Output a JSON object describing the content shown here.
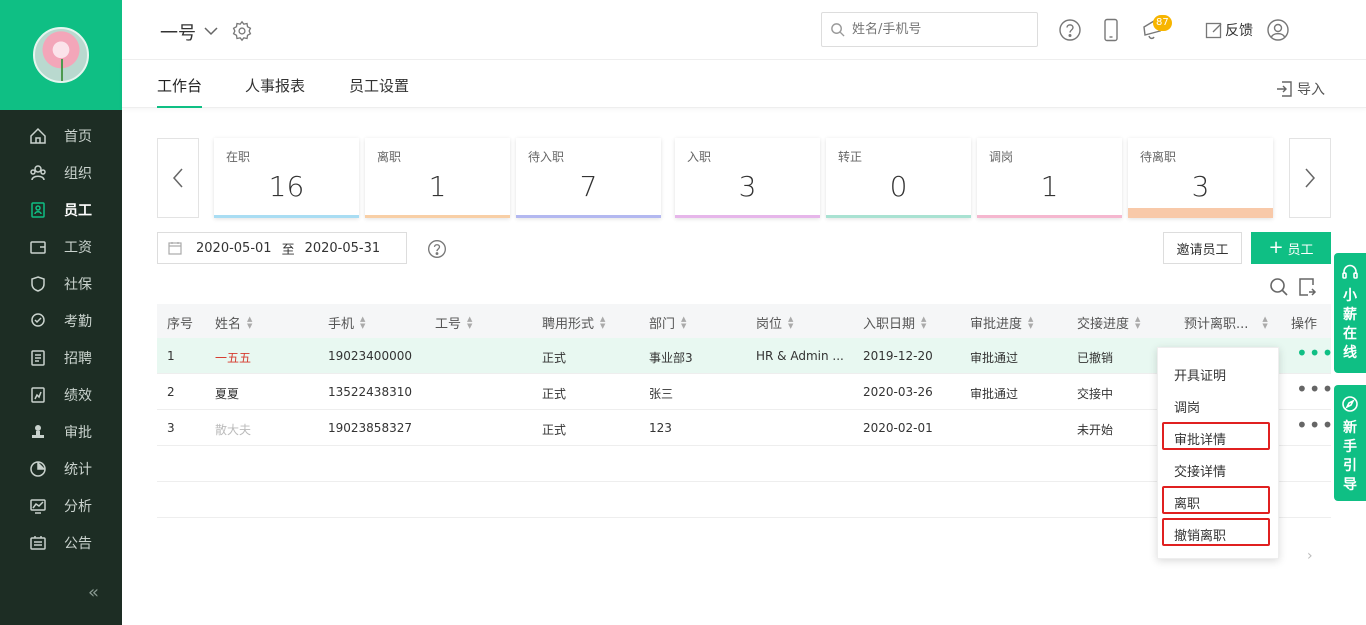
{
  "sidebar": {
    "items": [
      {
        "label": "首页",
        "icon": "home-icon",
        "active": false
      },
      {
        "label": "组织",
        "icon": "org-icon",
        "active": false
      },
      {
        "label": "员工",
        "icon": "employee-icon",
        "active": true
      },
      {
        "label": "工资",
        "icon": "wallet-icon",
        "active": false
      },
      {
        "label": "社保",
        "icon": "shield-icon",
        "active": false
      },
      {
        "label": "考勤",
        "icon": "location-check-icon",
        "active": false
      },
      {
        "label": "招聘",
        "icon": "recruit-icon",
        "active": false
      },
      {
        "label": "绩效",
        "icon": "performance-icon",
        "active": false
      },
      {
        "label": "审批",
        "icon": "stamp-icon",
        "active": false
      },
      {
        "label": "统计",
        "icon": "pie-chart-icon",
        "active": false
      },
      {
        "label": "分析",
        "icon": "analysis-icon",
        "active": false
      },
      {
        "label": "公告",
        "icon": "notice-icon",
        "active": false
      }
    ],
    "collapse_glyph": "«"
  },
  "header": {
    "company": "一号",
    "search_placeholder": "姓名/手机号",
    "notification_count": "87",
    "feedback": "反馈"
  },
  "tabs": [
    {
      "label": "工作台",
      "active": true
    },
    {
      "label": "人事报表",
      "active": false
    },
    {
      "label": "员工设置",
      "active": false
    }
  ],
  "import_label": "导入",
  "stats": [
    {
      "label": "在职",
      "value": "16",
      "color": "#a9ddf3"
    },
    {
      "label": "离职",
      "value": "1",
      "color": "#f8cfa6"
    },
    {
      "label": "待入职",
      "value": "7",
      "color": "#b3b8f0"
    },
    {
      "label": "入职",
      "value": "3",
      "color": "#e6b6ea"
    },
    {
      "label": "转正",
      "value": "0",
      "color": "#a9e2d2"
    },
    {
      "label": "调岗",
      "value": "1",
      "color": "#f5b7cf"
    },
    {
      "label": "待离职",
      "value": "3",
      "color": "#f8c9a9"
    }
  ],
  "filter": {
    "date_start": "2020-05-01",
    "date_sep": "至",
    "date_end": "2020-05-31",
    "invite_label": "邀请员工",
    "add_label": "员工"
  },
  "table": {
    "headers": [
      "序号",
      "姓名",
      "手机",
      "工号",
      "聘用形式",
      "部门",
      "岗位",
      "入职日期",
      "审批进度",
      "交接进度",
      "预计离职...",
      "操作"
    ],
    "rows": [
      {
        "no": "1",
        "name": "一五五",
        "phone": "19023400000",
        "job_no": "",
        "type": "正式",
        "dept": "事业部3",
        "post": "HR & Admin ...",
        "join_date": "2019-12-20",
        "approval": "审批通过",
        "handover": "已撤销",
        "expected": ""
      },
      {
        "no": "2",
        "name": "夏夏",
        "phone": "13522438310",
        "job_no": "",
        "type": "正式",
        "dept": "张三",
        "post": "",
        "join_date": "2020-03-26",
        "approval": "审批通过",
        "handover": "交接中",
        "expected": ""
      },
      {
        "no": "3",
        "name": "散大夫",
        "phone": "19023858327",
        "job_no": "",
        "type": "正式",
        "dept": "123",
        "post": "",
        "join_date": "2020-02-01",
        "approval": "",
        "handover": "未开始",
        "expected": ""
      }
    ]
  },
  "menu": {
    "items": [
      "开具证明",
      "调岗",
      "审批详情",
      "交接详情",
      "离职",
      "撤销离职"
    ]
  },
  "float_tabs": [
    {
      "label": "小薪在线",
      "icon": "headset-icon"
    },
    {
      "label": "新手引导",
      "icon": "compass-icon"
    }
  ],
  "pager_next": "›",
  "colors": {
    "accent": "#0fbf84",
    "sidebar": "#1d2d24",
    "highlight": "#e8f8f1",
    "alert": "#e02020"
  }
}
